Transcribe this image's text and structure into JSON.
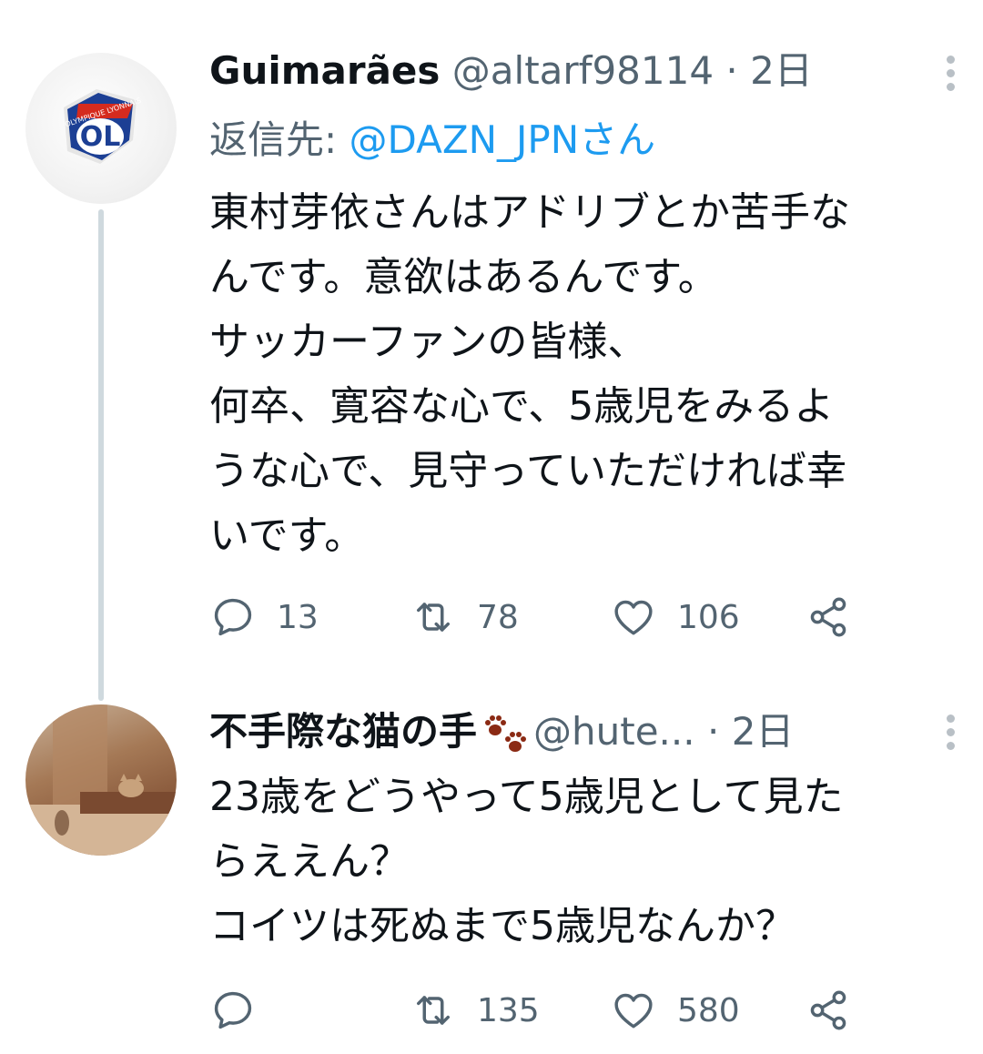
{
  "tweets": [
    {
      "name": "Guimarães",
      "handle": "@altarf98114",
      "separator": "·",
      "time": "2日",
      "replying_prefix": "返信先: ",
      "replying_to": "@DAZN_JPNさん",
      "body": "東村芽依さんはアドリブとか苦手な\nんです。意欲はあるんです。\nサッカーファンの皆様、\n何卒、寛容な心で、5歳児をみるよ\nうな心で、見守っていただければ幸\nいです。",
      "replies": "13",
      "retweets": "78",
      "likes": "106",
      "avatar_logo_text": "OL",
      "avatar_ring_text": "OLYMPIQUE LYONNAIS"
    },
    {
      "name": "不手際な猫の手",
      "handle": "@hute...",
      "separator": "·",
      "time": "2日",
      "body": "23歳をどうやって5歳児として見た\nらええん？\nコイツは死ぬまで5歳児なんか？",
      "replies": "",
      "retweets": "135",
      "likes": "580"
    }
  ],
  "icons": {
    "reply": "reply-icon",
    "retweet": "retweet-icon",
    "like": "heart-icon",
    "share": "share-icon",
    "more": "more-icon",
    "paw": "paw-prints-icon"
  },
  "colors": {
    "text": "#0f1419",
    "secondary": "#536471",
    "link": "#1d9bf0",
    "thread_line": "#cfd9de",
    "paw": "#8b2a14"
  }
}
